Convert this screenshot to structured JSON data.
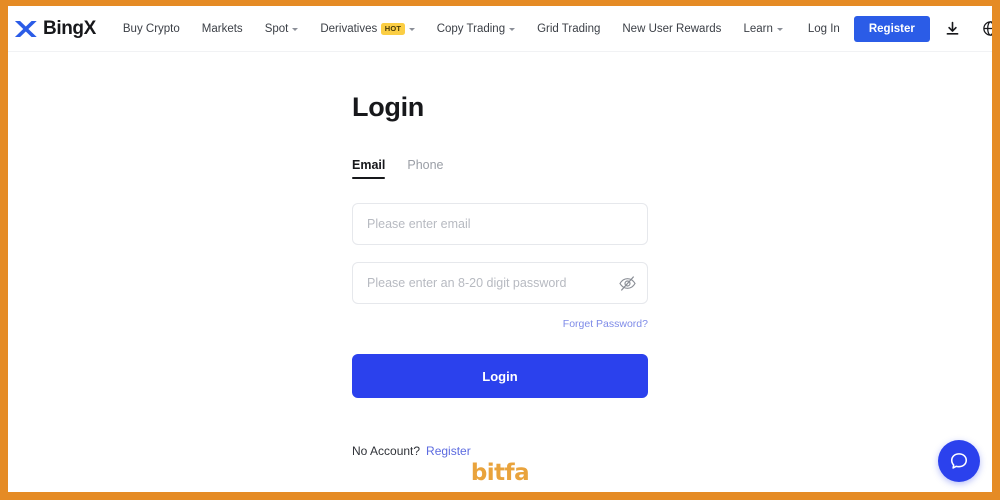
{
  "frame": {
    "border_color": "#E58B25"
  },
  "navbar": {
    "brand": {
      "logo_icon": "bingx-x-logo-icon",
      "name": "BingX"
    },
    "left_items": [
      {
        "label": "Buy Crypto",
        "caret": false,
        "badge": null
      },
      {
        "label": "Markets",
        "caret": false,
        "badge": null
      },
      {
        "label": "Spot",
        "caret": true,
        "badge": null
      },
      {
        "label": "Derivatives",
        "caret": true,
        "badge": "HOT"
      },
      {
        "label": "Copy Trading",
        "caret": true,
        "badge": null
      },
      {
        "label": "Grid Trading",
        "caret": false,
        "badge": null
      },
      {
        "label": "New User Rewards",
        "caret": false,
        "badge": null
      },
      {
        "label": "Learn",
        "caret": true,
        "badge": null
      }
    ],
    "login_label": "Log In",
    "register_label": "Register",
    "download_icon": "download-icon",
    "language_icon": "globe-icon",
    "badge_bg": "#FBCE44",
    "register_bg": "#2B5CE7"
  },
  "login": {
    "title": "Login",
    "tabs": [
      {
        "label": "Email",
        "active": true
      },
      {
        "label": "Phone",
        "active": false
      }
    ],
    "email": {
      "value": "",
      "placeholder": "Please enter email"
    },
    "password": {
      "value": "",
      "placeholder": "Please enter an 8-20 digit password",
      "toggle_icon": "eye-off-icon"
    },
    "forget_password_label": "Forget Password?",
    "submit_label": "Login",
    "no_account_text": "No Account?",
    "register_link_label": "Register",
    "submit_bg": "#2B41ED",
    "link_color": "#5C6BE0"
  },
  "watermark": {
    "text": "bitfa",
    "color": "#E9A33C"
  },
  "chat": {
    "icon": "chat-bubble-icon",
    "bg": "#2B41ED"
  }
}
